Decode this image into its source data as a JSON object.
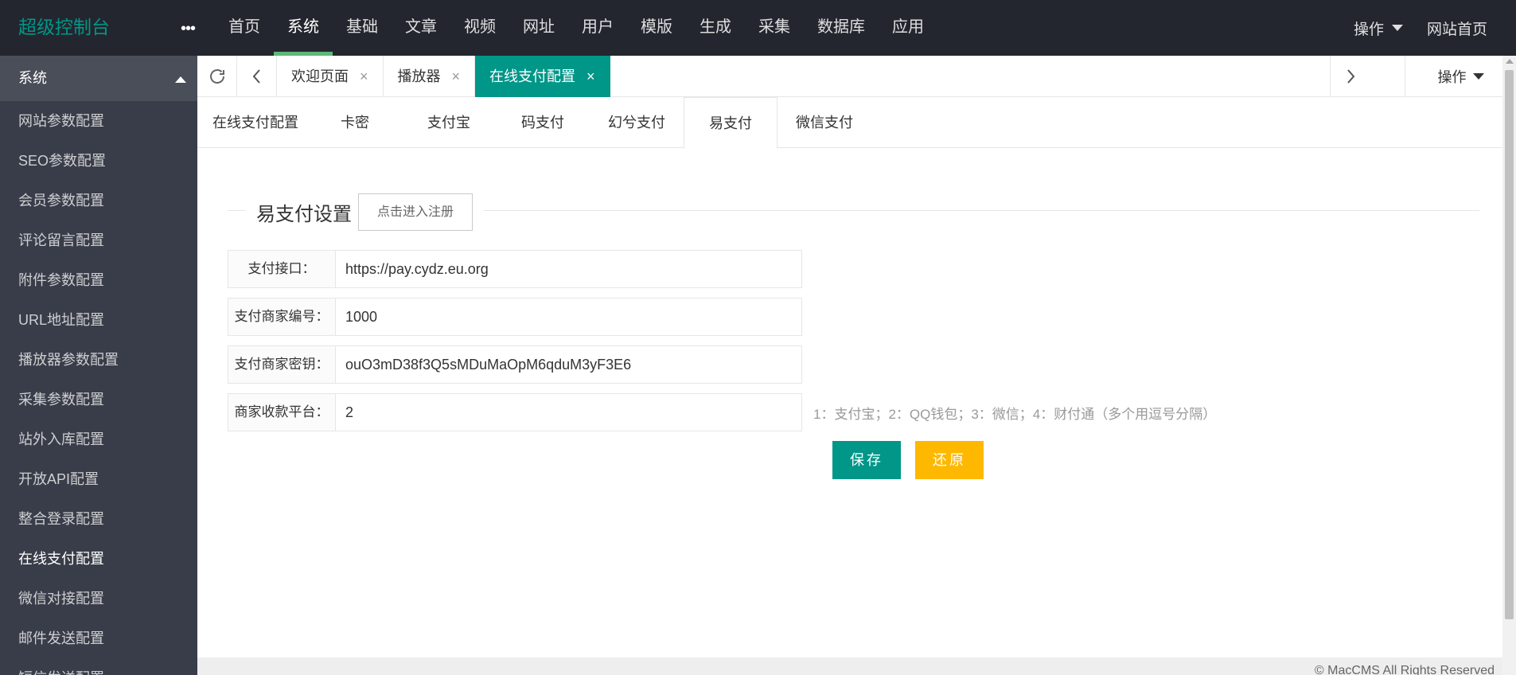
{
  "header": {
    "logo": "超级控制台",
    "more_icon": "ellipsis-icon",
    "nav": [
      "首页",
      "系统",
      "基础",
      "文章",
      "视频",
      "网址",
      "用户",
      "模版",
      "生成",
      "采集",
      "数据库",
      "应用"
    ],
    "active_nav": "系统",
    "operate_label": "操作",
    "home_label": "网站首页"
  },
  "sidebar": {
    "section_title": "系统",
    "items": [
      "网站参数配置",
      "SEO参数配置",
      "会员参数配置",
      "评论留言配置",
      "附件参数配置",
      "URL地址配置",
      "播放器参数配置",
      "采集参数配置",
      "站外入库配置",
      "开放API配置",
      "整合登录配置",
      "在线支付配置",
      "微信对接配置",
      "邮件发送配置",
      "短信发送配置"
    ],
    "active_item": "在线支付配置"
  },
  "tabbar": {
    "tabs": [
      "欢迎页面",
      "播放器",
      "在线支付配置"
    ],
    "active_tab": "在线支付配置",
    "operate_label": "操作",
    "close_glyph": "×"
  },
  "subtabs": {
    "items": [
      "在线支付配置",
      "卡密",
      "支付宝",
      "码支付",
      "幻兮支付",
      "易支付",
      "微信支付"
    ],
    "active": "易支付"
  },
  "form": {
    "legend_title": "易支付设置",
    "register_button": "点击进入注册",
    "fields": [
      {
        "label": "支付接口：",
        "value": "https://pay.cydz.eu.org",
        "hint": ""
      },
      {
        "label": "支付商家编号：",
        "value": "1000",
        "hint": ""
      },
      {
        "label": "支付商家密钥：",
        "value": "ouO3mD38f3Q5sMDuMaOpM6qduM3yF3E6",
        "hint": ""
      },
      {
        "label": "商家收款平台：",
        "value": "2",
        "hint": "1：支付宝；2：QQ钱包；3：微信；4：财付通（多个用逗号分隔）"
      }
    ],
    "save_label": "保存",
    "reset_label": "还原"
  },
  "footer": {
    "copyright": "© MacCMS All Rights Reserved"
  },
  "colors": {
    "primary": "#009688",
    "warm": "#FFB800",
    "header_bg": "#23262e",
    "sidebar_bg": "#393d49",
    "nav_underline": "#5FB878"
  }
}
